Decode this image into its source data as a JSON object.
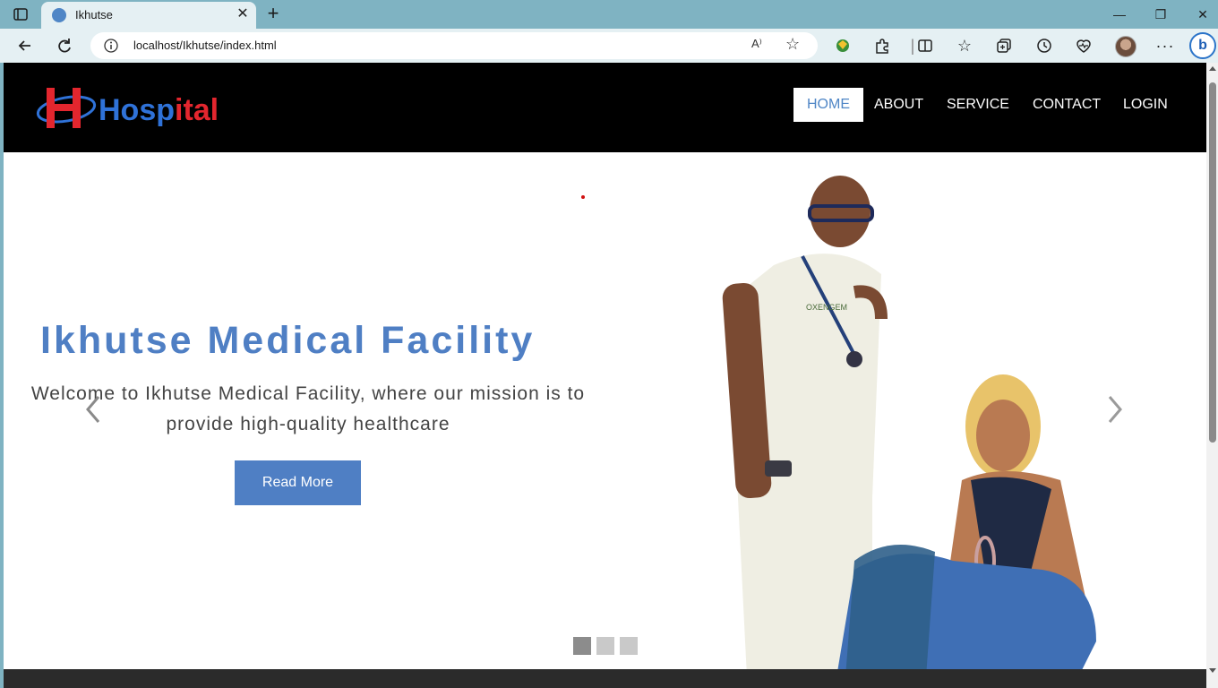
{
  "browser": {
    "tab_title": "Ikhutse",
    "url": "localhost/Ikhutse/index.html",
    "read_aloud_label": "A⁾"
  },
  "site": {
    "logo": {
      "letter": "H",
      "word_blue": "Hosp",
      "word_red": "ital"
    },
    "nav": [
      {
        "label": "HOME",
        "active": true
      },
      {
        "label": "ABOUT",
        "active": false
      },
      {
        "label": "SERVICE",
        "active": false
      },
      {
        "label": "CONTACT",
        "active": false
      },
      {
        "label": "LOGIN",
        "active": false
      }
    ],
    "hero": {
      "title": "Ikhutse Medical Facility",
      "subtitle": "Welcome to Ikhutse Medical Facility, where our mission is to provide high-quality healthcare",
      "button": "Read More",
      "slides": 3,
      "active_slide": 1
    }
  },
  "colors": {
    "accent": "#4f7fc4",
    "logo_blue": "#2f72d8",
    "logo_red": "#e3262e",
    "header_bg": "#000000"
  },
  "icons": [
    "tab-actions-icon",
    "close-icon",
    "plus-icon",
    "back-icon",
    "refresh-icon",
    "info-icon",
    "read-aloud-icon",
    "star-icon",
    "extension-icon",
    "puzzle-icon",
    "split-screen-icon",
    "favorites-icon",
    "collections-icon",
    "history-icon",
    "performance-icon",
    "profile-avatar",
    "more-icon",
    "copilot-icon",
    "chevron-left-icon",
    "chevron-right-icon"
  ]
}
